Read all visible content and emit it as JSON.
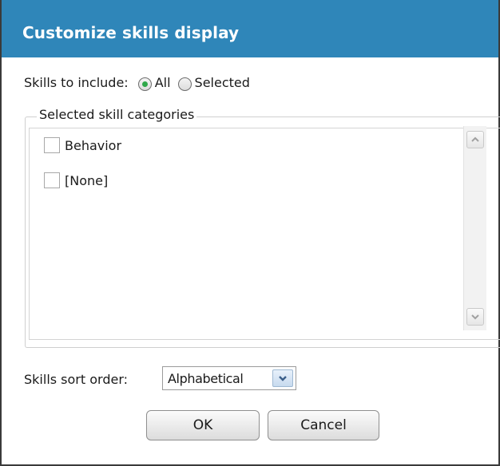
{
  "dialog": {
    "title": "Customize skills display"
  },
  "include": {
    "label": "Skills to include:",
    "options": [
      {
        "label": "All",
        "checked": true
      },
      {
        "label": "Selected",
        "checked": false
      }
    ]
  },
  "categories": {
    "legend": "Selected skill categories",
    "items": [
      {
        "label": "Behavior",
        "checked": false
      },
      {
        "label": "[None]",
        "checked": false
      }
    ]
  },
  "sort": {
    "label": "Skills sort order:",
    "value": "Alphabetical"
  },
  "buttons": {
    "ok": "OK",
    "cancel": "Cancel"
  },
  "colors": {
    "title_bar": "#2f86b9",
    "radio_selected": "#2fa84a"
  },
  "icons": {
    "scroll_up": "chevron-up-icon",
    "scroll_down": "chevron-down-icon",
    "dropdown": "chevron-down-icon"
  }
}
